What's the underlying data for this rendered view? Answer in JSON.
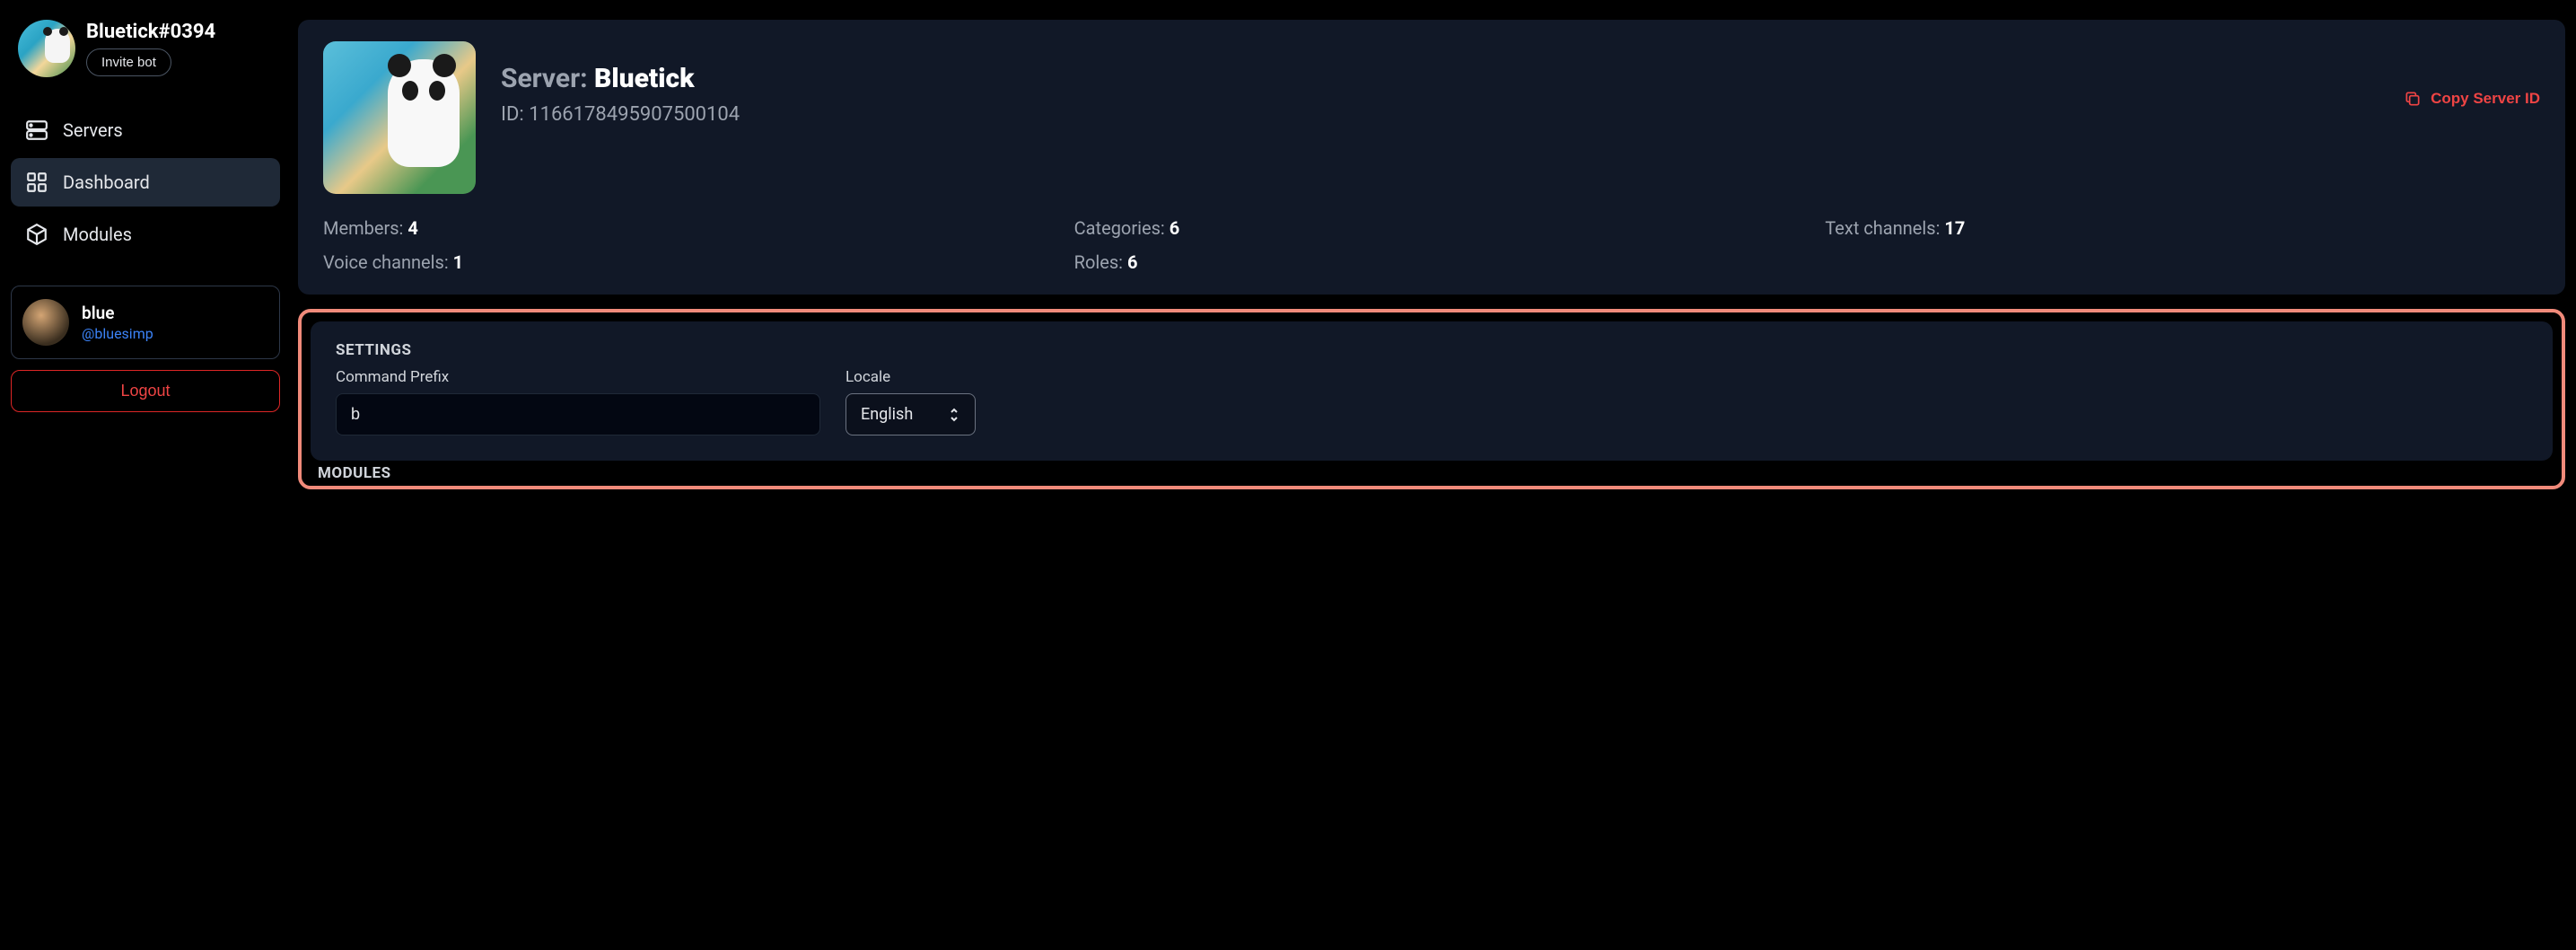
{
  "sidebar": {
    "bot_name": "Bluetick#0394",
    "invite_label": "Invite bot",
    "nav": [
      {
        "label": "Servers",
        "icon": "servers-icon",
        "active": false
      },
      {
        "label": "Dashboard",
        "icon": "dashboard-icon",
        "active": true
      },
      {
        "label": "Modules",
        "icon": "modules-icon",
        "active": false
      }
    ],
    "user": {
      "name": "blue",
      "handle": "@bluesimp"
    },
    "logout_label": "Logout"
  },
  "server": {
    "title_prefix": "Server:",
    "name": "Bluetick",
    "id_label": "ID:",
    "id_value": "1166178495907500104",
    "copy_label": "Copy Server ID",
    "stats": {
      "members_label": "Members:",
      "members_value": "4",
      "categories_label": "Categories:",
      "categories_value": "6",
      "text_channels_label": "Text channels:",
      "text_channels_value": "17",
      "voice_channels_label": "Voice channels:",
      "voice_channels_value": "1",
      "roles_label": "Roles:",
      "roles_value": "6"
    }
  },
  "settings": {
    "heading": "SETTINGS",
    "prefix_label": "Command Prefix",
    "prefix_value": "b",
    "locale_label": "Locale",
    "locale_value": "English"
  },
  "modules": {
    "heading": "MODULES"
  }
}
